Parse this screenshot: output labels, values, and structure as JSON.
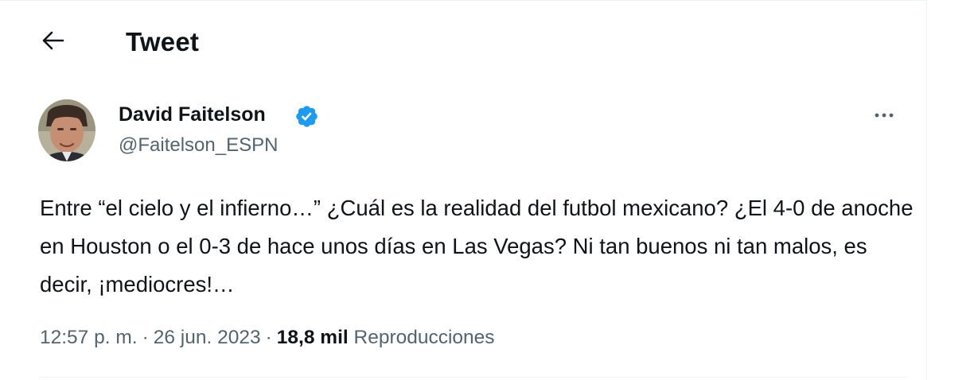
{
  "header": {
    "title": "Tweet",
    "back_icon": "arrow-left-icon"
  },
  "author": {
    "display_name": "David Faitelson",
    "handle": "@Faitelson_ESPN",
    "verified": true,
    "verified_color": "#1d9bf0",
    "more_icon": "more-horizontal-icon"
  },
  "tweet": {
    "text": "Entre “el cielo y el infierno…” ¿Cuál es la realidad del futbol mexicano? ¿El 4-0 de anoche en Houston o el 0-3 de hace unos días en Las Vegas? Ni tan buenos ni tan malos, es decir, ¡mediocres!…"
  },
  "meta": {
    "time": "12:57 p. m.",
    "separator": "·",
    "date": "26 jun. 2023",
    "views_count": "18,8 mil",
    "views_label": "Reproducciones"
  },
  "colors": {
    "text": "#0f1419",
    "secondary": "#536471",
    "divider": "#eff3f4"
  }
}
